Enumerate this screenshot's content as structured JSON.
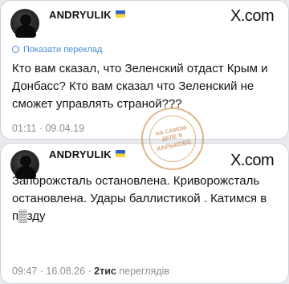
{
  "posts": [
    {
      "username": "ANDRYULIK",
      "platform": "X.com",
      "translate_label": "Показати переклад",
      "text": "Кто вам сказал, что Зеленский отдаст Крым и Донбасс? Кто вам сказал что Зеленский не сможет управлять страной???",
      "time": "01:11 · 09.04.19"
    },
    {
      "username": "ANDRYULIK",
      "platform": "X.com",
      "text": "Запорожсталь остановлена. Криворожсталь остановлена. Удары баллистикой . Катимся в п▒зду",
      "time": "09:47 · 16.08.26 · ",
      "views_count": "2тис",
      "views_label": " переглядів"
    }
  ],
  "watermark": {
    "text_top": "НА САМОМ ДЕЛЕ В",
    "text_bottom": "ХАРЬКОВЕ"
  }
}
